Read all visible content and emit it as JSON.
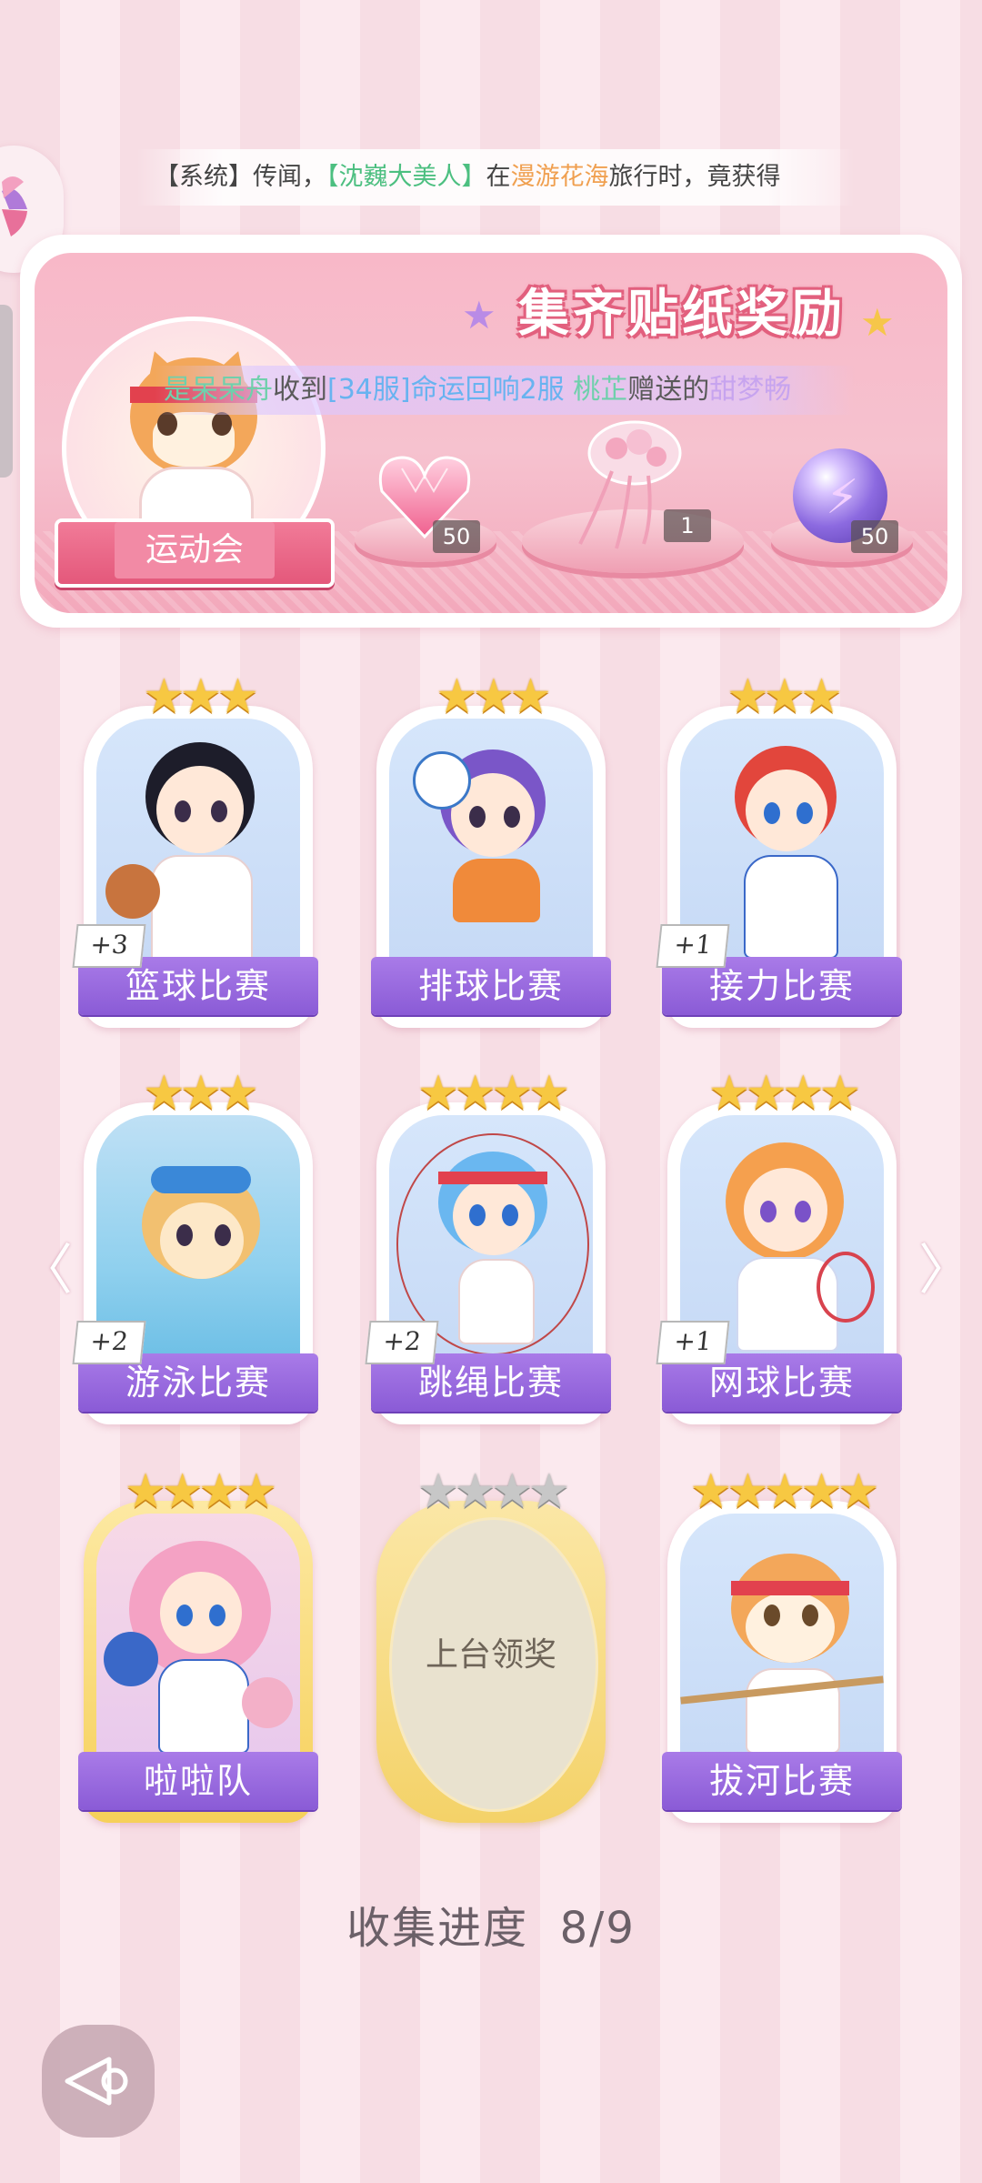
{
  "marquee": {
    "prefix": "【系统】传闻，",
    "name": "【沈巍大美人】",
    "mid": "在",
    "place": "漫游花海",
    "suffix": "旅行时，竟获得"
  },
  "banner": {
    "title": "集齐贴纸奖励",
    "event_label": "运动会",
    "gift_message": {
      "sender": "是呆呆舟",
      "verb": "收到",
      "server": "[34服]命运回响2服",
      "recipient": "桃芷",
      "action": "赠送的",
      "gift": "甜梦畅"
    },
    "rewards": [
      {
        "icon": "heart-gem-icon",
        "count": "50"
      },
      {
        "icon": "jellyfish-bouquet-icon",
        "count": "1"
      },
      {
        "icon": "lightning-orb-icon",
        "count": "50"
      }
    ]
  },
  "cards": [
    {
      "label": "篮球比赛",
      "stars": "★★★",
      "badge": "+3"
    },
    {
      "label": "排球比赛",
      "stars": "★★★",
      "badge": ""
    },
    {
      "label": "接力比赛",
      "stars": "★★★",
      "badge": "+1"
    },
    {
      "label": "游泳比赛",
      "stars": "★★★",
      "badge": "+2"
    },
    {
      "label": "跳绳比赛",
      "stars": "★★★★",
      "badge": "+2"
    },
    {
      "label": "网球比赛",
      "stars": "★★★★",
      "badge": "+1"
    },
    {
      "label": "啦啦队",
      "stars": "★★★★",
      "badge": ""
    },
    {
      "label": "上台领奖",
      "stars": "★★★★",
      "badge": "",
      "locked": true
    },
    {
      "label": "拔河比赛",
      "stars": "★★★★★",
      "badge": ""
    }
  ],
  "progress": {
    "label": "收集进度",
    "value": "8/9"
  },
  "colors": {
    "accent_purple": "#8a5bd6",
    "star_gold": "#f7c842",
    "banner_pink": "#f8b8c8"
  }
}
